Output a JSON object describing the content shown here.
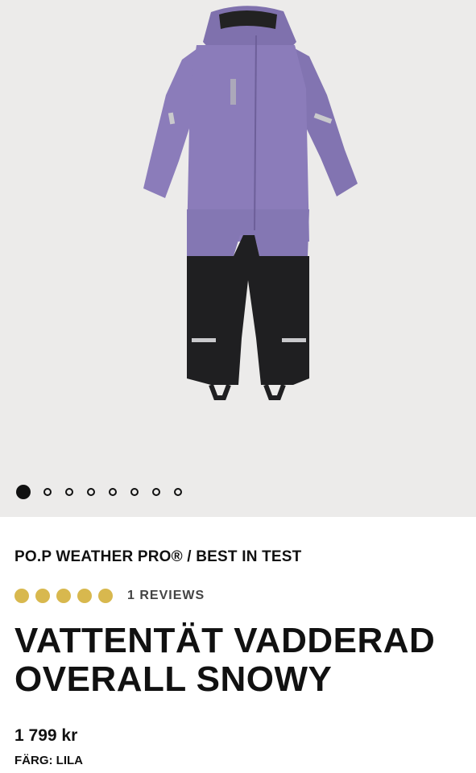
{
  "product": {
    "brand_line": "PO.P WEATHER PRO® / BEST IN TEST",
    "rating": 5,
    "rating_max": 5,
    "reviews_text": "1 REVIEWS",
    "title": "VATTENTÄT VADDERAD OVERALL SNOWY",
    "price": "1 799 kr",
    "color_label": "FÄRG: LILA"
  },
  "gallery": {
    "image_count": 8,
    "active_index": 0
  },
  "colors": {
    "gallery_background": "#ecebea",
    "suit_purple": "#8a7bb8",
    "suit_black": "#1f1f21",
    "rating_gold": "#d8b84e"
  }
}
